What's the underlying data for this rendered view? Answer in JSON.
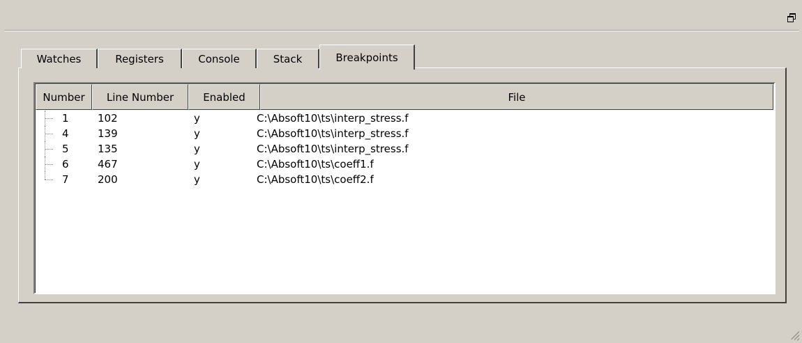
{
  "window": {
    "restore_icon": "restore-window-icon"
  },
  "tabs": [
    {
      "label": "Watches",
      "active": false
    },
    {
      "label": "Registers",
      "active": false
    },
    {
      "label": "Console",
      "active": false
    },
    {
      "label": "Stack",
      "active": false
    },
    {
      "label": "Breakpoints",
      "active": true
    }
  ],
  "breakpoints": {
    "columns": [
      "Number",
      "Line Number",
      "Enabled",
      "File"
    ],
    "rows": [
      {
        "number": "1",
        "line": "102",
        "enabled": "y",
        "file": "C:\\Absoft10\\ts\\interp_stress.f"
      },
      {
        "number": "4",
        "line": "139",
        "enabled": "y",
        "file": "C:\\Absoft10\\ts\\interp_stress.f"
      },
      {
        "number": "5",
        "line": "135",
        "enabled": "y",
        "file": "C:\\Absoft10\\ts\\interp_stress.f"
      },
      {
        "number": "6",
        "line": "467",
        "enabled": "y",
        "file": "C:\\Absoft10\\ts\\coeff1.f"
      },
      {
        "number": "7",
        "line": "200",
        "enabled": "y",
        "file": "C:\\Absoft10\\ts\\coeff2.f"
      }
    ]
  }
}
